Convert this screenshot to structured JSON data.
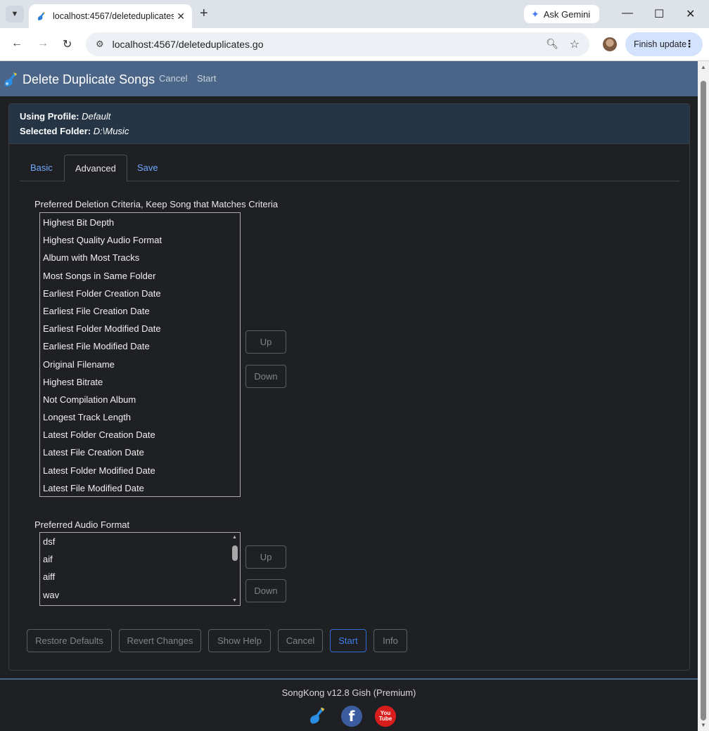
{
  "browser": {
    "tab_title": "localhost:4567/deleteduplicates",
    "ask_gemini": "Ask Gemini",
    "url": "localhost:4567/deleteduplicates.go",
    "finish_update": "Finish update"
  },
  "header": {
    "title": "Delete Duplicate Songs",
    "links": [
      "Cancel",
      "Start"
    ]
  },
  "profile": {
    "profile_label": "Using Profile:",
    "profile_value": "Default",
    "folder_label": "Selected Folder:",
    "folder_value": "D:\\Music"
  },
  "tabs": [
    "Basic",
    "Advanced",
    "Save"
  ],
  "active_tab": "Advanced",
  "deletion_criteria": {
    "label": "Preferred Deletion Criteria, Keep Song that Matches Criteria",
    "items": [
      "Highest Bit Depth",
      "Highest Quality Audio Format",
      "Album with Most Tracks",
      "Most Songs in Same Folder",
      "Earliest Folder Creation Date",
      "Earliest File Creation Date",
      "Earliest Folder Modified Date",
      "Earliest File Modified Date",
      "Original Filename",
      "Highest Bitrate",
      "Not Compilation Album",
      "Longest Track Length",
      "Latest Folder Creation Date",
      "Latest File Creation Date",
      "Latest Folder Modified Date",
      "Latest File Modified Date"
    ],
    "up": "Up",
    "down": "Down"
  },
  "audio_format": {
    "label": "Preferred Audio Format",
    "items": [
      "dsf",
      "aif",
      "aiff",
      "wav"
    ],
    "up": "Up",
    "down": "Down"
  },
  "actions": {
    "restore_defaults": "Restore Defaults",
    "revert_changes": "Revert Changes",
    "show_help": "Show Help",
    "cancel": "Cancel",
    "start": "Start",
    "info": "Info"
  },
  "footer": {
    "version": "SongKong v12.8 Gish (Premium)",
    "facebook_glyph": "f",
    "youtube_label": "You Tube"
  },
  "colors": {
    "header_bg": "#4a6587",
    "panel_head_bg": "#253546",
    "page_bg": "#1f2023",
    "link_blue": "#6ea8fe",
    "primary_blue": "#2f6fd6"
  }
}
